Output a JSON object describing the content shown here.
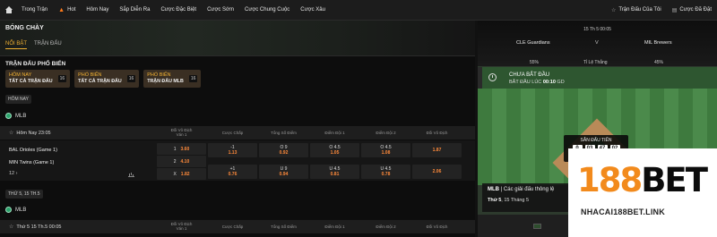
{
  "nav": {
    "items": [
      "Trong Trận",
      "Hot",
      "Hôm Nay",
      "Sắp Diễn Ra",
      "Cược Đặc Biệt",
      "Cược Sớm",
      "Cược Chung Cuộc",
      "Cược Xâu"
    ],
    "right": [
      "Trận Đấu Của Tôi",
      "Cược Đã Đặt"
    ]
  },
  "banner": {
    "title": "BÓNG CHÀY",
    "tabs": [
      "NỔI BẬT",
      "TRẬN ĐẤU"
    ]
  },
  "popular": {
    "title": "TRẬN ĐẤU PHỔ BIẾN",
    "cards": [
      {
        "t1": "HÔM NAY",
        "t2": "TẤT CẢ TRẬN ĐẤU",
        "count": "16"
      },
      {
        "t1": "PHỔ BIẾN",
        "t2": "TẤT CẢ TRẬN ĐẤU",
        "count": "16"
      },
      {
        "t1": "PHỔ BIẾN",
        "t2": "TRẬN ĐẤU MLB",
        "count": "16"
      }
    ]
  },
  "today_chip": "HÔM NAY",
  "league": "MLB",
  "columns": [
    "Đối Vô Địch\nVán 1",
    "Cược Chấp",
    "Tổng Số Điểm",
    "Điểm Đội 1",
    "Điểm Đội 2",
    "Đối Vô Địch"
  ],
  "match1": {
    "time": "Hôm Nay 23:05",
    "team1": "BAL Orioles (Game 1)",
    "team2": "MIN Twins (Game 1)",
    "more": "12 ›",
    "rows": [
      [
        {
          "l": "1",
          "v": "3.60"
        },
        {
          "l": "-1",
          "v": "1.13"
        },
        {
          "l": "O 9",
          "v": "0.92"
        },
        {
          "l": "O 4.5",
          "v": "1.05"
        },
        {
          "l": "O 4.5",
          "v": "1.08"
        },
        {
          "l": "",
          "v": "1.87"
        }
      ],
      [
        {
          "l": "2",
          "v": "4.10"
        }
      ],
      [
        {
          "l": "X",
          "v": "1.82"
        },
        {
          "l": "+1",
          "v": "0.76"
        },
        {
          "l": "U 9",
          "v": "0.94"
        },
        {
          "l": "U 4.5",
          "v": "0.81"
        },
        {
          "l": "U 4.5",
          "v": "0.78"
        },
        {
          "l": "",
          "v": "2.06"
        }
      ]
    ]
  },
  "day2_chip": "THỨ 5, 15 TH.5",
  "league2": "MLB",
  "match2": {
    "time": "Thứ 5 15 Th.5 00:05"
  },
  "right": {
    "date": "15 Th 5 00:05",
    "team1": "CLE Guardians",
    "vs": "V",
    "team2": "MIL Brewers",
    "pct1": "55%",
    "pct_label": "Tỉ Lệ Thắng",
    "pct2": "45%",
    "status": "CHƯA BẮT ĐẦU",
    "start_label": "BẮT ĐẦU LÚC",
    "start_time": "00:10",
    "start_suffix": "GD",
    "countdown": {
      "title": "SẮN ĐẤU TIẾN",
      "units": [
        {
          "v": "0",
          "l": "NGÀY"
        },
        {
          "v": "03",
          "l": "GIỜ"
        },
        {
          "v": "47",
          "l": "PHÚT"
        },
        {
          "v": "02",
          "l": "GIÂY"
        }
      ]
    },
    "info_league": "MLB",
    "info_text": "Các giải đấu thông lệ",
    "info_day": "Thứ 5",
    "info_date": ", 15 Tháng 5"
  },
  "logo": {
    "main1": "188",
    "main2": "BET",
    "sub": "NHACAI188BET.LINK"
  }
}
